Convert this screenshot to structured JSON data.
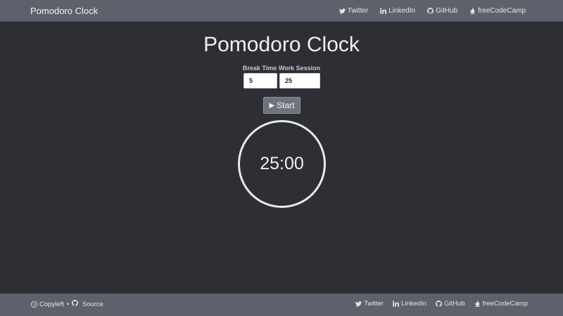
{
  "navbar": {
    "brand": "Pomodoro Clock",
    "links": [
      {
        "label": "Twitter",
        "icon": "twitter-icon"
      },
      {
        "label": "LinkedIn",
        "icon": "linkedin-icon"
      },
      {
        "label": "GitHub",
        "icon": "github-icon"
      },
      {
        "label": "freeCodeCamp",
        "icon": "freecodecamp-icon"
      }
    ]
  },
  "main": {
    "title": "Pomodoro Clock",
    "break_label": "Break Time",
    "work_label": "Work Session",
    "break_value": "5",
    "work_value": "25",
    "start_label": "Start",
    "clock_time": "25:00"
  },
  "footer": {
    "copyleft": "Copyleft",
    "separator": "•",
    "source": "Source",
    "links": [
      {
        "label": "Twitter",
        "icon": "twitter-icon"
      },
      {
        "label": "LinkedIn",
        "icon": "linkedin-icon"
      },
      {
        "label": "GitHub",
        "icon": "github-icon"
      },
      {
        "label": "freeCodeCamp",
        "icon": "freecodecamp-icon"
      }
    ]
  },
  "colors": {
    "background": "#2e2f35",
    "bar": "#5e616b",
    "button": "#70737c",
    "ring": "#e8e9ec"
  }
}
